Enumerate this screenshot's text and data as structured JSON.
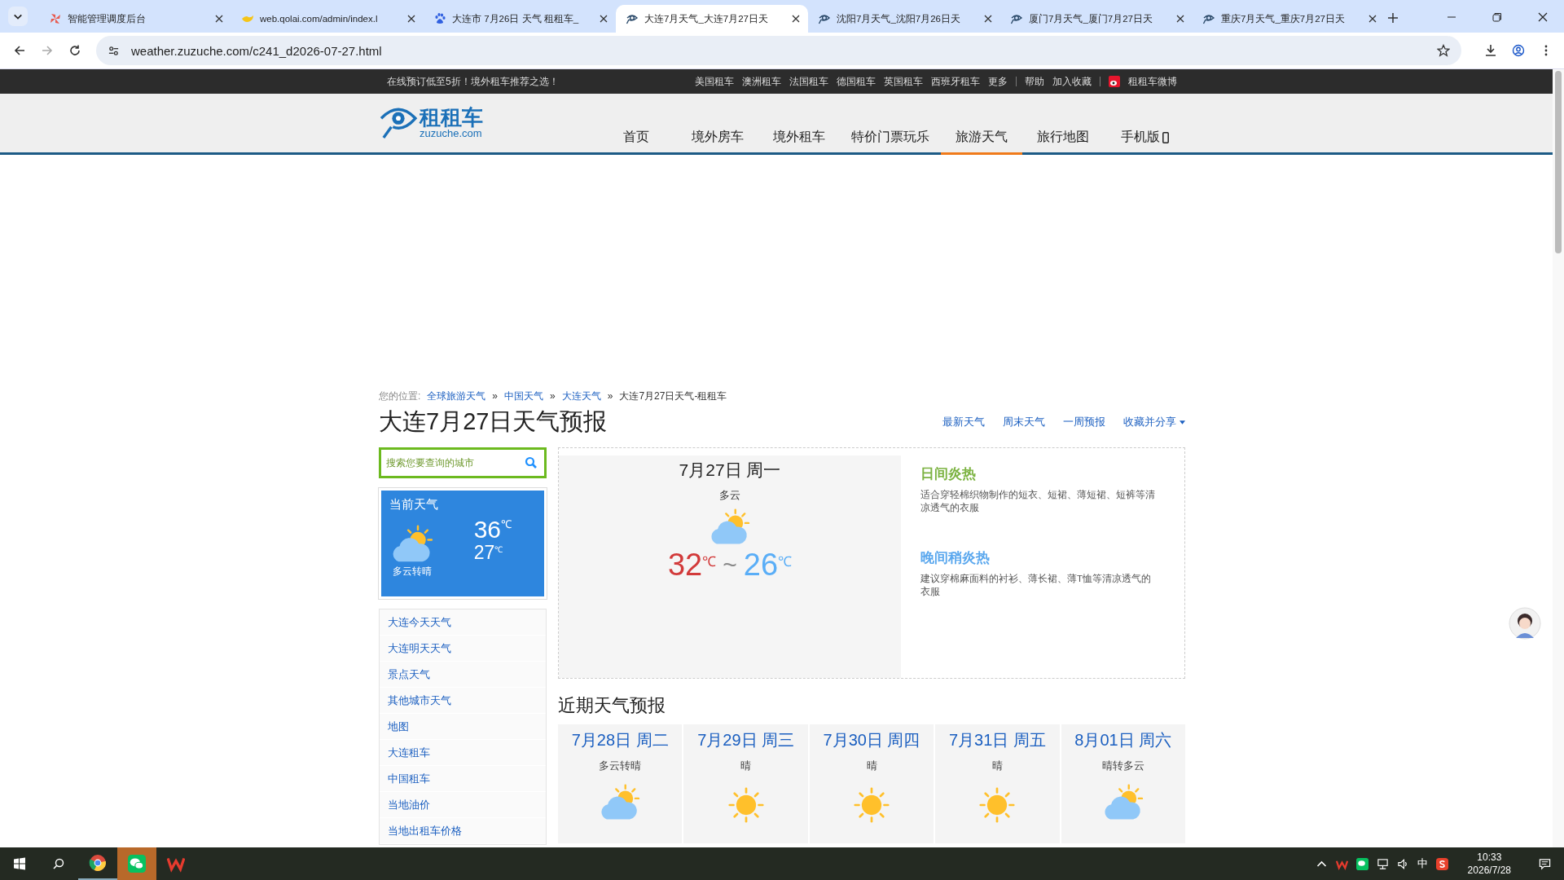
{
  "browser": {
    "tabs": [
      {
        "title": "智能管理调度后台",
        "kind": "pinwheel",
        "selected": false
      },
      {
        "title": "web.qolai.com/admin/index.l",
        "kind": "bird",
        "selected": false
      },
      {
        "title": "大连市 7月26日 天气 租租车_",
        "kind": "paw",
        "selected": false
      },
      {
        "title": "大连7月天气_大连7月27日天",
        "kind": "eye",
        "selected": true
      },
      {
        "title": "沈阳7月天气_沈阳7月26日天",
        "kind": "eye",
        "selected": false
      },
      {
        "title": "厦门7月天气_厦门7月27日天",
        "kind": "eye",
        "selected": false
      },
      {
        "title": "重庆7月天气_重庆7月27日天",
        "kind": "eye",
        "selected": false
      }
    ],
    "url": "weather.zuzuche.com/c241_d2026-07-27.html"
  },
  "topbar": {
    "promo": "在线预订低至5折！境外租车推荐之选！",
    "links": [
      "美国租车",
      "澳洲租车",
      "法国租车",
      "德国租车",
      "英国租车",
      "西班牙租车",
      "更多",
      "帮助",
      "加入收藏"
    ],
    "weibo": "租租车微博"
  },
  "logo": {
    "name": "租租车",
    "domain": "zuzuche.com"
  },
  "nav": [
    {
      "label": "首页",
      "kind": "link",
      "selected": false
    },
    {
      "label": "境外房车",
      "kind": "link",
      "selected": false
    },
    {
      "label": "境外租车",
      "kind": "link",
      "selected": false
    },
    {
      "label": "特价门票玩乐",
      "kind": "link",
      "selected": false
    },
    {
      "label": "旅游天气",
      "kind": "link",
      "selected": true
    },
    {
      "label": "旅行地图",
      "kind": "link",
      "selected": false
    },
    {
      "label": "手机版",
      "kind": "mobile",
      "selected": false
    }
  ],
  "breadcrumb": {
    "label": "您的位置:",
    "items": [
      {
        "label": "全球旅游天气",
        "separator": "»"
      },
      {
        "label": "中国天气",
        "separator": "»"
      },
      {
        "label": "大连天气",
        "separator": "»"
      }
    ],
    "current": "大连7月27日天气-租租车"
  },
  "title": "大连7月27日天气预报",
  "title_links": [
    "最新天气",
    "周末天气",
    "一周预报",
    "收藏并分享"
  ],
  "search": {
    "placeholder": "搜索您要查询的城市"
  },
  "current": {
    "heading": "当前天气",
    "high": {
      "value": "36",
      "unit": "℃"
    },
    "low": {
      "value": "27",
      "unit": "℃"
    },
    "condition": "多云转晴",
    "kind": "partly_cloudy"
  },
  "sidebar_links": [
    "大连今天天气",
    "大连明天天气",
    "景点天气",
    "其他城市天气",
    "地图",
    "大连租车",
    "中国租车",
    "当地油价",
    "当地出租车价格"
  ],
  "today": {
    "date": "7月27日 周一",
    "condition": "多云",
    "kind": "partly_cloudy",
    "high": {
      "value": "32",
      "unit": "℃"
    },
    "low": {
      "value": "26",
      "unit": "℃"
    },
    "separator": "~"
  },
  "tips": [
    {
      "title": "日间炎热",
      "text": "适合穿轻棉织物制作的短衣、短裙、薄短裙、短裤等清凉透气的衣服",
      "color": "#7cb342"
    },
    {
      "title": "晚间稍炎热",
      "text": "建议穿棉麻面料的衬衫、薄长裙、薄T恤等清凉透气的衣服",
      "color": "#5ba8ee"
    }
  ],
  "forecast_title": "近期天气预报",
  "forecast": [
    {
      "date": "7月28日 周二",
      "condition": "多云转晴",
      "kind": "partly_cloudy"
    },
    {
      "date": "7月29日 周三",
      "condition": "晴",
      "kind": "sunny"
    },
    {
      "date": "7月30日 周四",
      "condition": "晴",
      "kind": "sunny"
    },
    {
      "date": "7月31日 周五",
      "condition": "晴",
      "kind": "sunny"
    },
    {
      "date": "8月01日 周六",
      "condition": "晴转多云",
      "kind": "partly_cloudy"
    }
  ],
  "taskbar": {
    "ime": "中",
    "time": "10:33",
    "date": "2026/7/28"
  }
}
